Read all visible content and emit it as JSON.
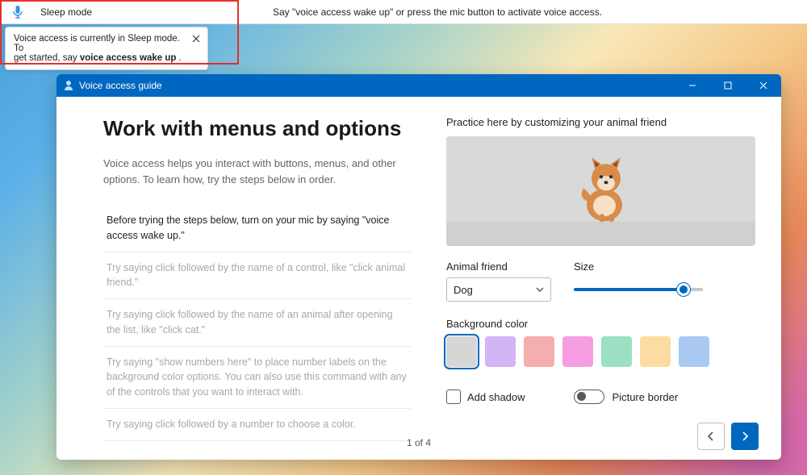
{
  "voice_bar": {
    "status": "Sleep mode",
    "hint": "Say \"voice access wake up\" or press the mic button to activate voice access."
  },
  "tooltip": {
    "line1": "Voice access is currently in Sleep mode. To",
    "line2_a": "get started, say ",
    "line2_b": "voice access wake up",
    "line2_c": " ."
  },
  "window": {
    "title": "Voice access guide"
  },
  "page": {
    "heading": "Work with menus and options",
    "intro": "Voice access helps you interact with buttons, menus, and other options. To learn how, try the steps below in order.",
    "steps": [
      "Before trying the steps below, turn on your mic by saying \"voice access wake up.\"",
      "Try saying click followed by the name of a control, like \"click animal friend.\"",
      "Try saying click followed by the name of an animal after opening the list, like \"click cat.\"",
      "Try saying \"show numbers here\" to place number labels on the background color options. You can also use this command with any of the controls that you want to interact with.",
      "Try saying click followed by a number to choose a color."
    ],
    "indicator": "1 of 4"
  },
  "practice": {
    "title": "Practice here by customizing your animal friend",
    "animal_label": "Animal friend",
    "animal_value": "Dog",
    "size_label": "Size",
    "size_value": 85,
    "bg_label": "Background color",
    "swatches": [
      "#d6d6d6",
      "#d2b5f5",
      "#f5aeb0",
      "#f59de0",
      "#9be0c2",
      "#fcdca0",
      "#a9c8f2"
    ],
    "selected_swatch": 0,
    "add_shadow_label": "Add shadow",
    "picture_border_label": "Picture border"
  }
}
